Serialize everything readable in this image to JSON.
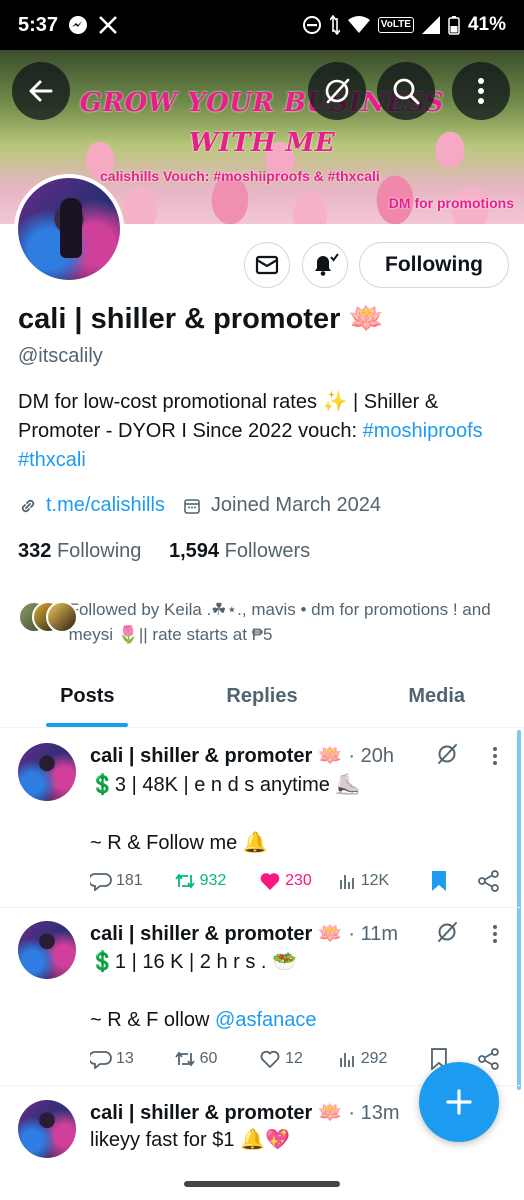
{
  "status_bar": {
    "time": "5:37",
    "volte": "VoLTE",
    "battery": "41%"
  },
  "banner": {
    "title_line1": "GROW YOUR BUSINESS",
    "title_line2": "WITH ME",
    "subtitle": "calishills  Vouch: #moshiiproofs & #thxcali",
    "dm_text": "DM for promotions"
  },
  "profile": {
    "following_button": "Following",
    "display_name": "cali | shiller & promoter 🪷",
    "handle": "@itscalily",
    "bio_text": "DM for low-cost promotional rates ✨ | Shiller & Promoter - DYOR I Since 2022 vouch: ",
    "bio_tag1": "#moshiproofs",
    "bio_tag2": "#thxcali",
    "link": "t.me/calishills",
    "joined": "Joined March 2024",
    "following_count": "332",
    "following_label": "Following",
    "followers_count": "1,594",
    "followers_label": "Followers",
    "followed_by": "Followed by Keila .☘︎⋆., mavis • dm for promotions ! and meysi 🌷|| rate starts at ₱5"
  },
  "tabs": [
    {
      "label": "Posts",
      "active": true
    },
    {
      "label": "Replies",
      "active": false
    },
    {
      "label": "Media",
      "active": false
    }
  ],
  "posts": [
    {
      "name": "cali | shiller & promoter 🪷",
      "time": "· 20h",
      "line1": "💲3 | 48K | e n d s anytime ⛸️",
      "line2": "~ R & Follow me 🔔",
      "mention": "",
      "replies": "181",
      "reposts": "932",
      "likes": "230",
      "views": "12K",
      "reposted": true,
      "liked": true,
      "bookmarked": true
    },
    {
      "name": "cali | shiller & promoter 🪷",
      "time": "· 11m",
      "line1": "💲1 | 16 K | 2 h r s . 🥗",
      "line2": "~ R & F ollow ",
      "mention": "@asfanace",
      "replies": "13",
      "reposts": "60",
      "likes": "12",
      "views": "292",
      "reposted": false,
      "liked": false,
      "bookmarked": false
    },
    {
      "name": "cali | shiller & promoter 🪷",
      "time": "· 13m",
      "line1": "likeyy fast for $1 🔔💖"
    }
  ],
  "colors": {
    "accent": "#1d9bf0",
    "like": "#f91880",
    "repost": "#00ba7c",
    "banner_text": "#e81e8c"
  }
}
